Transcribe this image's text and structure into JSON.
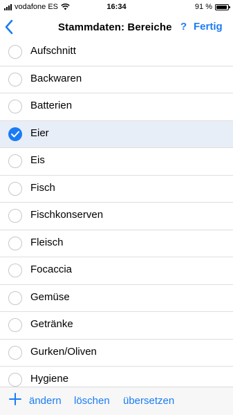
{
  "status": {
    "carrier": "vodafone ES",
    "time": "16:34",
    "battery": "91 %",
    "battery_level": 0.91
  },
  "nav": {
    "title": "Stammdaten: Bereiche",
    "help": "?",
    "done": "Fertig",
    "back_icon": "chevron-left-icon"
  },
  "list": {
    "items": [
      {
        "label": "Aufschnitt",
        "selected": false
      },
      {
        "label": "Backwaren",
        "selected": false
      },
      {
        "label": "Batterien",
        "selected": false
      },
      {
        "label": "Eier",
        "selected": true
      },
      {
        "label": "Eis",
        "selected": false
      },
      {
        "label": "Fisch",
        "selected": false
      },
      {
        "label": "Fischkonserven",
        "selected": false
      },
      {
        "label": "Fleisch",
        "selected": false
      },
      {
        "label": "Focaccia",
        "selected": false
      },
      {
        "label": "Gemüse",
        "selected": false
      },
      {
        "label": "Getränke",
        "selected": false
      },
      {
        "label": "Gurken/Oliven",
        "selected": false
      },
      {
        "label": "Hygiene",
        "selected": false
      }
    ]
  },
  "toolbar": {
    "add_icon": "plus-icon",
    "edit": "ändern",
    "delete": "löschen",
    "translate": "übersetzen"
  },
  "colors": {
    "accent": "#1a7cf5",
    "selected_row": "#e8eef8"
  }
}
